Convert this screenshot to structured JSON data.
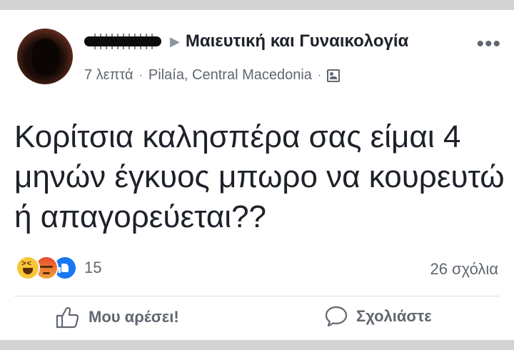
{
  "post": {
    "author_redacted": true,
    "group_name": "Μαιευτική και Γυναικολογία",
    "time": "7 λεπτά",
    "location": "Pilaía, Central Macedonia",
    "separator": "·",
    "text": "Κορίτσια καλησπέρα σας είμαι 4 μηνών έγκυος μπωρο να κουρευτώ ή απαγορεύεται??"
  },
  "reactions": {
    "types": [
      "haha",
      "angry",
      "like"
    ],
    "count": "15"
  },
  "comments": {
    "count_label": "26 σχόλια"
  },
  "actions": {
    "like_label": "Μου αρέσει!",
    "comment_label": "Σχολιάστε"
  },
  "colors": {
    "background": "#d3d3d3",
    "card": "#ffffff",
    "text_primary": "#1d2129",
    "text_secondary": "#606770",
    "like_blue": "#1877f2"
  },
  "icons": [
    "more-icon",
    "arrow-right-icon",
    "group-privacy-icon",
    "haha-reaction-icon",
    "angry-reaction-icon",
    "like-reaction-icon",
    "thumbs-up-icon",
    "comment-bubble-icon"
  ]
}
